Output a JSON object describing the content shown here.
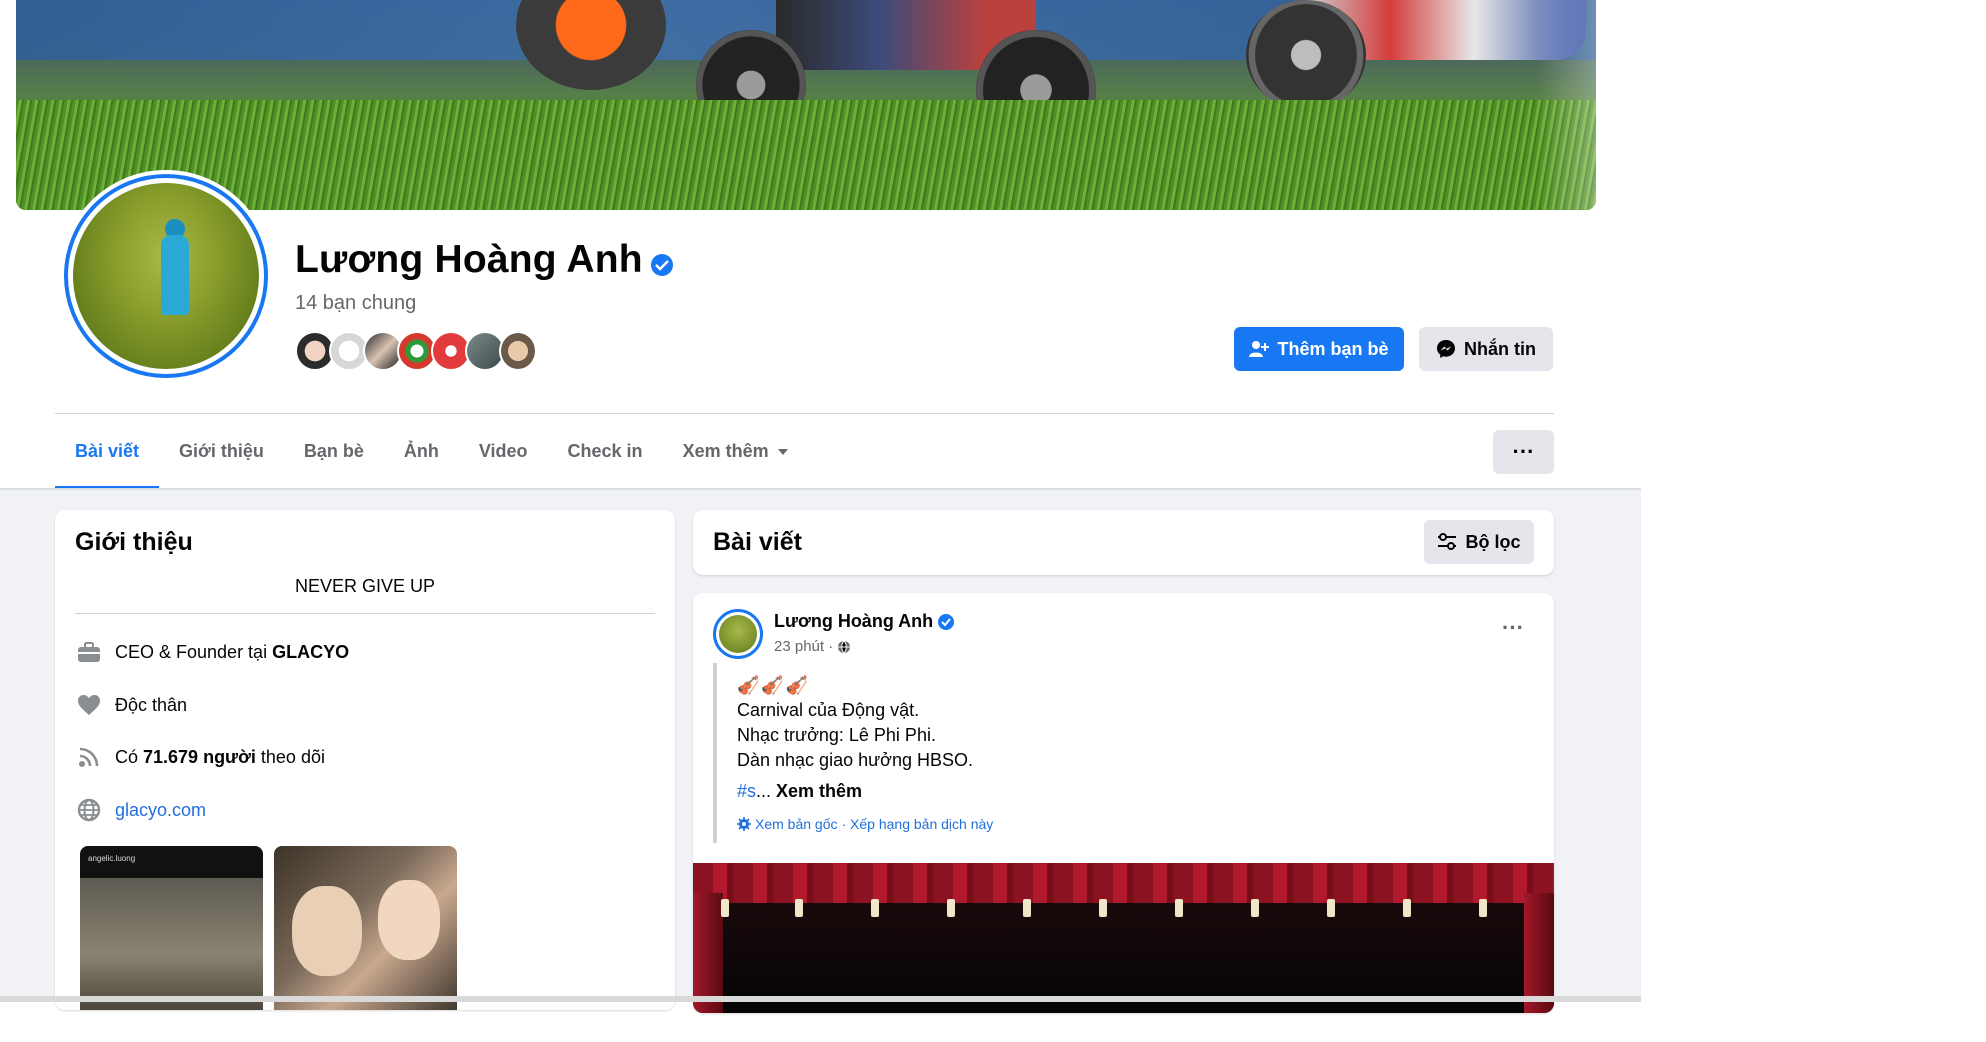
{
  "profile": {
    "name": "Lương Hoàng Anh",
    "mutual_friends": "14 bạn chung",
    "add_friend_label": "Thêm bạn bè",
    "message_label": "Nhắn tin"
  },
  "tabs": [
    {
      "label": "Bài viết"
    },
    {
      "label": "Giới thiệu"
    },
    {
      "label": "Bạn bè"
    },
    {
      "label": "Ảnh"
    },
    {
      "label": "Video"
    },
    {
      "label": "Check in"
    },
    {
      "label": "Xem thêm"
    }
  ],
  "intro": {
    "title": "Giới thiệu",
    "bio": "NEVER GIVE UP",
    "work_prefix": "CEO & Founder tại ",
    "work_company": "GLACYO",
    "relationship": "Độc thân",
    "followers_prefix": "Có ",
    "followers_count": "71.679 người",
    "followers_suffix": " theo dõi",
    "website": "glacyo.com",
    "photo1_caption": "angelic.luong"
  },
  "posts": {
    "title": "Bài viết",
    "filter_label": "Bộ lọc",
    "post": {
      "author": "Lương Hoàng Anh",
      "time": "23 phút ·",
      "emoji": "🎻🎻🎻",
      "lines": [
        "Carnival của Động vật.",
        "Nhạc trưởng: Lê Phi Phi.",
        "Dàn nhạc giao hưởng HBSO."
      ],
      "hashtag": "#s",
      "ellipsis": "... ",
      "see_more": "Xem thêm",
      "see_original": "Xem bản gốc",
      "rate_translation": "· Xếp hạng bản dịch này"
    }
  },
  "colors": {
    "accent": "#1877f2",
    "secondary_button": "#e4e6eb",
    "page_bg": "#f0f2f5"
  }
}
